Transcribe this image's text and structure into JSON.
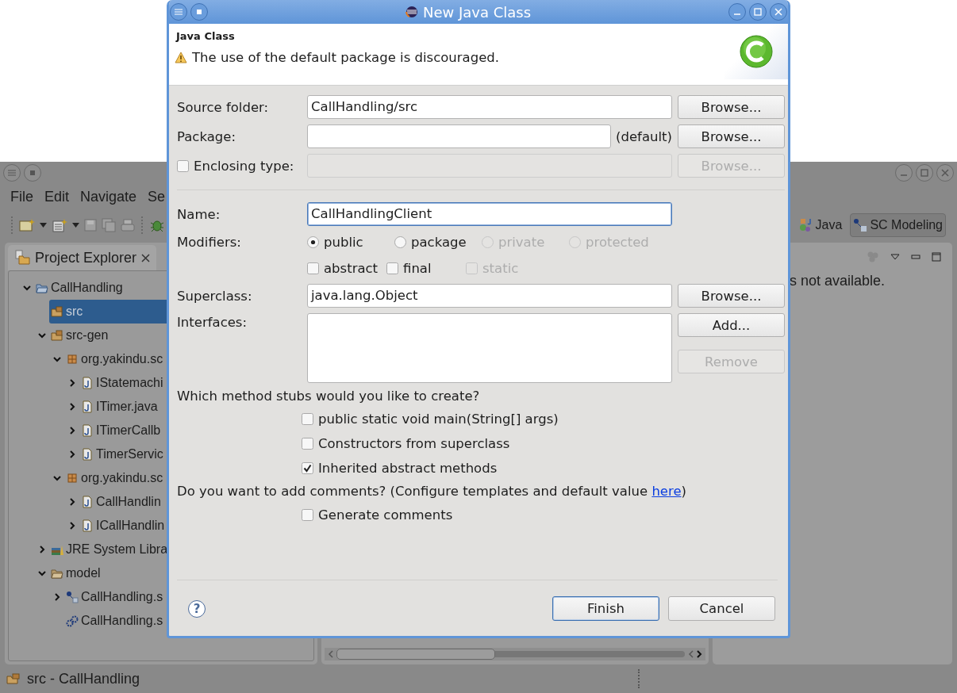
{
  "ide": {
    "menu": [
      {
        "label": "File"
      },
      {
        "label": "Edit"
      },
      {
        "label": "Navigate"
      },
      {
        "label": "Se"
      }
    ],
    "perspectives": [
      {
        "label": "Java",
        "selected": false
      },
      {
        "label": "SC Modeling",
        "selected": true
      }
    ],
    "explorer": {
      "title": "Project Explorer",
      "tree": [
        {
          "label": "CallHandling",
          "kind": "project",
          "expanded": true,
          "selected": false,
          "children": [
            {
              "label": "src",
              "kind": "source-folder",
              "selected": true
            },
            {
              "label": "src-gen",
              "kind": "source-folder",
              "expanded": true,
              "selected": false,
              "children": [
                {
                  "label": "org.yakindu.sc",
                  "kind": "package",
                  "expanded": true,
                  "selected": false,
                  "children": [
                    {
                      "label": "IStatemachi",
                      "kind": "java-file",
                      "expanded": false,
                      "selected": false
                    },
                    {
                      "label": "ITimer.java",
                      "kind": "java-file",
                      "expanded": false,
                      "selected": false
                    },
                    {
                      "label": "ITimerCallb",
                      "kind": "java-file",
                      "expanded": false,
                      "selected": false
                    },
                    {
                      "label": "TimerServic",
                      "kind": "java-file",
                      "expanded": false,
                      "selected": false
                    }
                  ]
                },
                {
                  "label": "org.yakindu.sc",
                  "kind": "package",
                  "expanded": true,
                  "selected": false,
                  "children": [
                    {
                      "label": "CallHandlin",
                      "kind": "java-file",
                      "expanded": false,
                      "selected": false
                    },
                    {
                      "label": "ICallHandlin",
                      "kind": "java-file",
                      "expanded": false,
                      "selected": false
                    }
                  ]
                }
              ]
            },
            {
              "label": "JRE System Libra",
              "kind": "library",
              "expanded": false,
              "selected": false
            },
            {
              "label": "model",
              "kind": "folder",
              "expanded": true,
              "selected": false,
              "children": [
                {
                  "label": "CallHandling.s",
                  "kind": "statechart",
                  "expanded": false,
                  "selected": false
                },
                {
                  "label": "CallHandling.s",
                  "kind": "config",
                  "selected": false
                }
              ]
            }
          ]
        }
      ]
    },
    "right_view": {
      "message": "s not available."
    },
    "status_bar": {
      "text": "src - CallHandling"
    }
  },
  "dialog": {
    "title": "New Java Class",
    "header": {
      "title": "Java Class",
      "message": "The use of the default package is discouraged."
    },
    "source_folder": {
      "label": "Source folder:",
      "value": "CallHandling/src",
      "button": {
        "label": "Browse...",
        "disabled": false
      }
    },
    "package": {
      "label": "Package:",
      "suffix": "(default)",
      "button": {
        "label": "Browse...",
        "disabled": false
      }
    },
    "enclosing_type": {
      "label": "Enclosing type:",
      "checked": false,
      "disabled": true,
      "button": {
        "label": "Browse...",
        "disabled": true
      }
    },
    "name": {
      "label": "Name:",
      "value": "CallHandlingClient",
      "focused": true
    },
    "modifiers": {
      "label": "Modifiers:",
      "access": [
        {
          "label": "public",
          "selected": true,
          "disabled": false
        },
        {
          "label": "package",
          "selected": false,
          "disabled": false
        },
        {
          "label": "private",
          "selected": false,
          "disabled": true
        },
        {
          "label": "protected",
          "selected": false,
          "disabled": true
        }
      ],
      "flags": [
        {
          "label": "abstract",
          "checked": false,
          "disabled": false
        },
        {
          "label": "final",
          "checked": false,
          "disabled": false
        },
        {
          "label": "static",
          "checked": false,
          "disabled": true
        }
      ]
    },
    "superclass": {
      "label": "Superclass:",
      "value": "java.lang.Object",
      "button": {
        "label": "Browse...",
        "disabled": false
      }
    },
    "interfaces": {
      "label": "Interfaces:",
      "buttons": [
        {
          "label": "Add...",
          "disabled": false
        },
        {
          "label": "Remove",
          "disabled": true
        }
      ]
    },
    "stubs": {
      "question": "Which method stubs would you like to create?",
      "options": [
        {
          "label": "public static void main(String[] args)",
          "checked": false
        },
        {
          "label": "Constructors from superclass",
          "checked": false
        },
        {
          "label": "Inherited abstract methods",
          "checked": true
        }
      ]
    },
    "comments": {
      "question": "Do you want to add comments? (Configure templates and default value ",
      "link": "here",
      "question_end": ")",
      "options": [
        {
          "label": "Generate comments",
          "checked": false
        }
      ]
    },
    "help": "?",
    "buttons": [
      {
        "label": "Finish",
        "default": true
      },
      {
        "label": "Cancel",
        "default": false
      }
    ]
  }
}
